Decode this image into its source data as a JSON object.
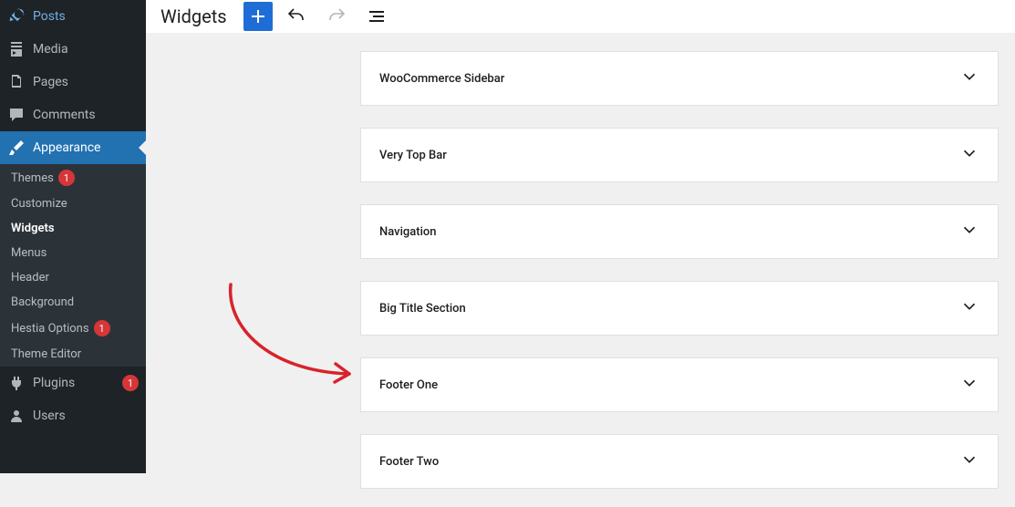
{
  "sidebar": {
    "items": [
      {
        "label": "Posts",
        "icon": "pin"
      },
      {
        "label": "Media",
        "icon": "media"
      },
      {
        "label": "Pages",
        "icon": "pages"
      },
      {
        "label": "Comments",
        "icon": "comments"
      },
      {
        "label": "Appearance",
        "icon": "brush",
        "active": true
      },
      {
        "label": "Plugins",
        "icon": "plugin",
        "badge": "1"
      },
      {
        "label": "Users",
        "icon": "users"
      }
    ],
    "appearance_submenu": [
      {
        "label": "Themes",
        "badge": "1"
      },
      {
        "label": "Customize"
      },
      {
        "label": "Widgets",
        "current": true
      },
      {
        "label": "Menus"
      },
      {
        "label": "Header"
      },
      {
        "label": "Background"
      },
      {
        "label": "Hestia Options",
        "badge": "1"
      },
      {
        "label": "Theme Editor"
      }
    ]
  },
  "topbar": {
    "title": "Widgets"
  },
  "widget_areas": [
    "WooCommerce Sidebar",
    "Very Top Bar",
    "Navigation",
    "Big Title Section",
    "Footer One",
    "Footer Two"
  ]
}
